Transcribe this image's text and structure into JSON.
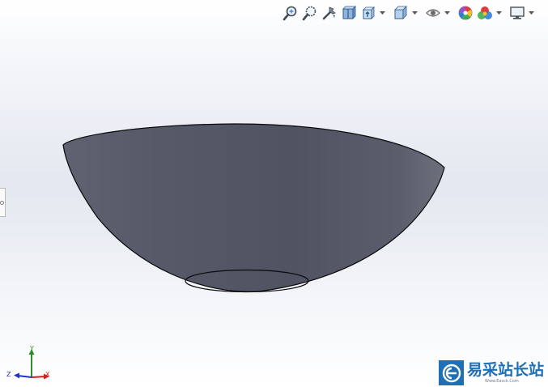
{
  "toolbar": {
    "buttons": [
      {
        "icon": "zoom-to-fit-icon"
      },
      {
        "icon": "zoom-to-area-icon"
      },
      {
        "icon": "previous-view-icon"
      },
      {
        "icon": "section-view-icon"
      },
      {
        "icon": "view-orientation-icon",
        "dropdown": true
      },
      {
        "icon": "display-style-icon",
        "dropdown": true
      },
      {
        "icon": "hide-show-items-icon",
        "dropdown": true
      },
      {
        "icon": "edit-appearance-icon"
      },
      {
        "icon": "apply-scene-icon",
        "dropdown": true
      },
      {
        "icon": "view-settings-icon",
        "dropdown": true
      }
    ]
  },
  "model": {
    "shape": "hemispherical bowl",
    "fill_color": "#555968",
    "edge_color": "#0a0a0a"
  },
  "triad": {
    "y_label": "Y",
    "z_label": "Z",
    "x_label": "X",
    "colors": {
      "x": "#d21f1f",
      "y": "#2e8b2e",
      "z": "#2233c8"
    }
  },
  "watermark": {
    "title": "易采站长站",
    "subtitle": "Www.Easck.Com"
  }
}
